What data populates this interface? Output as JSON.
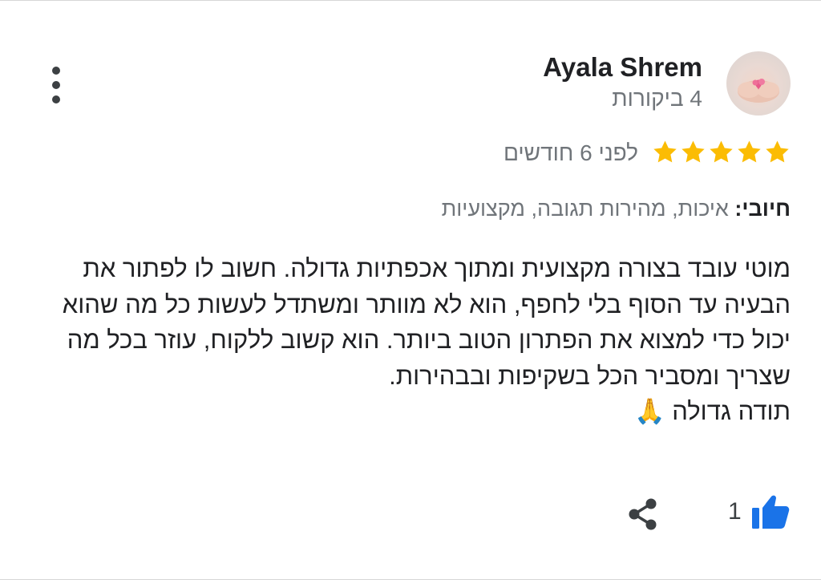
{
  "reviewer": {
    "name": "Ayala Shrem",
    "reviews_count": "4 ביקורות"
  },
  "review": {
    "rating": 5,
    "max_rating": 5,
    "time": "לפני 6 חודשים",
    "positives_label": "חיובי:",
    "positives_value": " איכות, מהירות תגובה, מקצועיות",
    "text_lines": [
      "מוטי עובד בצורה מקצועית ומתוך אכפתיות גדולה. חשוב לו לפתור את הבעיה עד הסוף בלי לחפף, הוא לא מוותר ומשתדל לעשות כל מה שהוא יכול כדי למצוא את הפתרון הטוב ביותר. הוא קשוב ללקוח, עוזר בכל מה שצריך ומסביר הכל בשקיפות ובבהירות.",
      "תודה גדולה 🙏"
    ]
  },
  "actions": {
    "like_count": "1",
    "like_icon": "thumbs-up-icon",
    "share_icon": "share-icon",
    "menu_icon": "more-vert-icon"
  },
  "colors": {
    "star": "#fbbc04",
    "like": "#1a73e8",
    "text_primary": "#202124",
    "text_secondary": "#70757a"
  }
}
